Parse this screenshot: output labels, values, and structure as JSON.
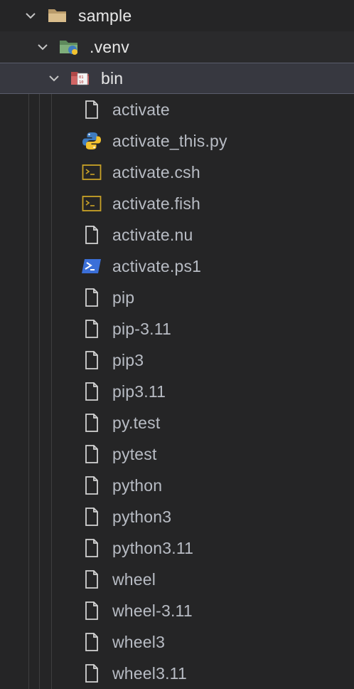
{
  "explorer": {
    "root": {
      "label": "sample",
      "icon": "folder-open-icon",
      "chevron": "chevron-down-icon"
    },
    "venv": {
      "label": ".venv",
      "icon": "python-folder-icon",
      "chevron": "chevron-down-icon"
    },
    "bin": {
      "label": "bin",
      "icon": "binary-folder-icon",
      "chevron": "chevron-down-icon"
    },
    "files": [
      {
        "label": "activate",
        "icon": "file-icon"
      },
      {
        "label": "activate_this.py",
        "icon": "python-icon"
      },
      {
        "label": "activate.csh",
        "icon": "terminal-icon"
      },
      {
        "label": "activate.fish",
        "icon": "terminal-icon"
      },
      {
        "label": "activate.nu",
        "icon": "file-icon"
      },
      {
        "label": "activate.ps1",
        "icon": "powershell-icon"
      },
      {
        "label": "pip",
        "icon": "file-icon"
      },
      {
        "label": "pip-3.11",
        "icon": "file-icon"
      },
      {
        "label": "pip3",
        "icon": "file-icon"
      },
      {
        "label": "pip3.11",
        "icon": "file-icon"
      },
      {
        "label": "py.test",
        "icon": "file-icon"
      },
      {
        "label": "pytest",
        "icon": "file-icon"
      },
      {
        "label": "python",
        "icon": "file-icon"
      },
      {
        "label": "python3",
        "icon": "file-icon"
      },
      {
        "label": "python3.11",
        "icon": "file-icon"
      },
      {
        "label": "wheel",
        "icon": "file-icon"
      },
      {
        "label": "wheel-3.11",
        "icon": "file-icon"
      },
      {
        "label": "wheel3",
        "icon": "file-icon"
      },
      {
        "label": "wheel3.11",
        "icon": "file-icon"
      }
    ]
  },
  "colors": {
    "background": "#252526",
    "selected_row": "#373840",
    "folder_text": "#e8e8e8",
    "file_text": "#b8bcc4",
    "terminal_icon": "#c9a227",
    "powershell_icon": "#3b6fd8",
    "python_blue": "#3f7cc0",
    "python_yellow": "#f2c230"
  }
}
